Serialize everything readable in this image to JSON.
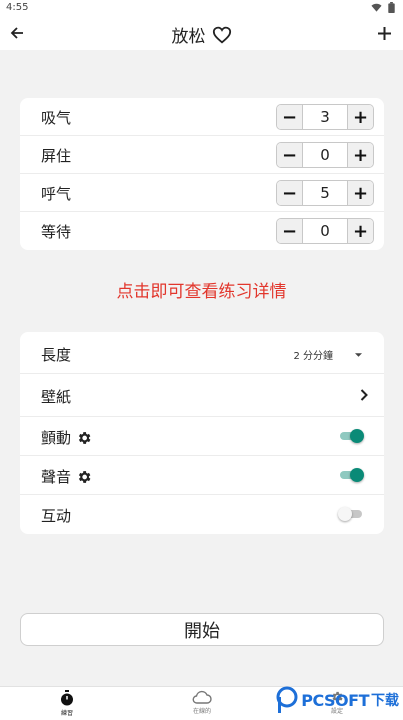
{
  "status_bar": {
    "time": "4:55"
  },
  "app_bar": {
    "title": "放松"
  },
  "breathing": [
    {
      "label": "吸气",
      "value": "3"
    },
    {
      "label": "屏住",
      "value": "0"
    },
    {
      "label": "呼气",
      "value": "5"
    },
    {
      "label": "等待",
      "value": "0"
    }
  ],
  "stepper": {
    "minus": "−",
    "plus": "+"
  },
  "detail_link": "点击即可查看练习详情",
  "settings": {
    "length": {
      "label": "長度",
      "value": "2 分分鐘"
    },
    "wallpaper": {
      "label": "壁紙"
    },
    "vibration": {
      "label": "顫動",
      "on": true
    },
    "sound": {
      "label": "聲音",
      "on": true
    },
    "interaction": {
      "label": "互动",
      "on": false
    }
  },
  "start_button": "開始",
  "bottom_nav": [
    {
      "label": "練習",
      "icon": "stopwatch-icon",
      "active": true
    },
    {
      "label": "在線的",
      "icon": "cloud-icon",
      "active": false
    },
    {
      "label": "設定",
      "icon": "settings-icon",
      "active": false
    }
  ],
  "watermark": {
    "text": "PCSOFT",
    "text_cn": "下载"
  },
  "colors": {
    "accent": "#0a8a77",
    "link_red": "#e2362c"
  }
}
